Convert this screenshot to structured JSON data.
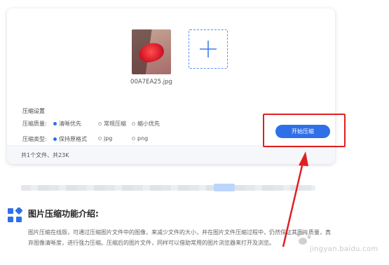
{
  "uploader": {
    "file_name": "00A7EA25.jpg",
    "add_icon": "plus-icon"
  },
  "settings": {
    "title": "压缩设置",
    "quality_label": "压缩质量:",
    "quality_options": [
      {
        "label": "清晰优先",
        "selected": true
      },
      {
        "label": "常规压缩",
        "selected": false
      },
      {
        "label": "缩小优先",
        "selected": false
      }
    ],
    "type_label": "压缩类型:",
    "type_options": [
      {
        "label": "保持原格式",
        "selected": true
      },
      {
        "label": "jpg",
        "selected": false
      },
      {
        "label": "png",
        "selected": false
      }
    ]
  },
  "footer": {
    "summary": "共1个文件、共23K"
  },
  "actions": {
    "start_label": "开始压缩"
  },
  "intro": {
    "title": "图片压缩功能介绍:",
    "line1": "图片压缩在线版，可通过压缩图片文件中的图像，来减少文件的大小，并在图片文件压缩过程中，仍然保证其图片质量，真",
    "line2": "弃图像清晰度，进行强力压缩。压缩后的图片文件，同样可以借助常用的图片浏览器来打开及浏览。"
  },
  "watermark": {
    "text": "jingyan.baidu.com"
  },
  "colors": {
    "accent": "#2f6fe8",
    "highlight": "#e02020"
  }
}
